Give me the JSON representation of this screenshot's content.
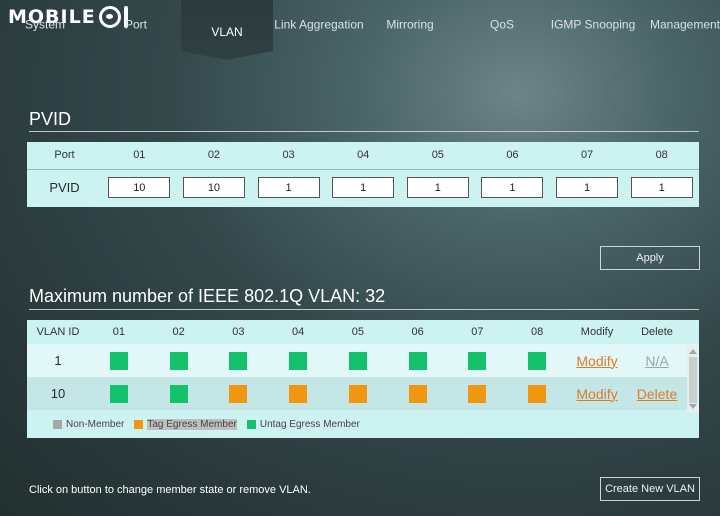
{
  "logo": {
    "text": "MOBILE"
  },
  "nav": {
    "tabs": [
      {
        "label": "System"
      },
      {
        "label": "Port"
      },
      {
        "label": "VLAN"
      },
      {
        "label": "Link Aggregation"
      },
      {
        "label": "Mirroring"
      },
      {
        "label": "QoS"
      },
      {
        "label": "IGMP Snooping"
      },
      {
        "label": "Management"
      }
    ],
    "active": "VLAN"
  },
  "pvid": {
    "title": "PVID",
    "port_header": "Port",
    "row_label": "PVID",
    "ports": [
      "01",
      "02",
      "03",
      "04",
      "05",
      "06",
      "07",
      "08"
    ],
    "values": [
      "10",
      "10",
      "1",
      "1",
      "1",
      "1",
      "1",
      "1"
    ],
    "apply_label": "Apply"
  },
  "vlan": {
    "title": "Maximum number of IEEE 802.1Q VLAN: 32",
    "headers": {
      "id": "VLAN ID",
      "modify": "Modify",
      "delete": "Delete"
    },
    "ports": [
      "01",
      "02",
      "03",
      "04",
      "05",
      "06",
      "07",
      "08"
    ],
    "rows": [
      {
        "id": "1",
        "members": [
          "untag",
          "untag",
          "untag",
          "untag",
          "untag",
          "untag",
          "untag",
          "untag"
        ],
        "modify": "Modify",
        "delete": "N/A"
      },
      {
        "id": "10",
        "members": [
          "untag",
          "untag",
          "tag",
          "tag",
          "tag",
          "tag",
          "tag",
          "tag"
        ],
        "modify": "Modify",
        "delete": "Delete"
      }
    ],
    "legend": {
      "non_member": "Non-Member",
      "tag": "Tag Egress Member",
      "untag": "Untag Egress Member"
    },
    "colors": {
      "untag": "#13c26b",
      "tag": "#f0960f",
      "non_member": "#a7a7a7"
    }
  },
  "footer": {
    "note": "Click on button to change member state or remove VLAN.",
    "create_label": "Create New VLAN"
  }
}
